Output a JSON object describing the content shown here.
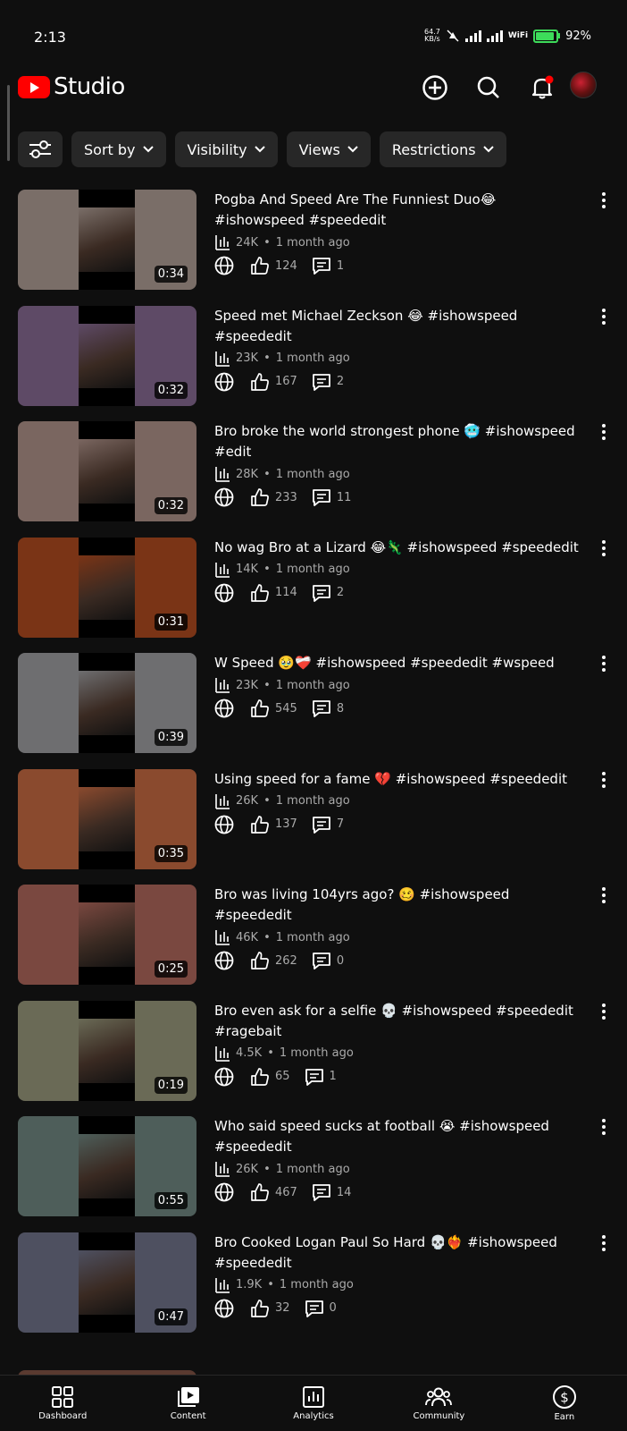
{
  "status_bar": {
    "time": "2:13",
    "net_speed_value": "64.7",
    "net_speed_unit": "KB/s",
    "wifi_label": "WiFi",
    "battery": "92%"
  },
  "header": {
    "app_name": "Studio"
  },
  "filters": [
    "Sort by",
    "Visibility",
    "Views",
    "Restrictions"
  ],
  "videos": [
    {
      "title": "Pogba And Speed Are The Funniest Duo😂 #ishowspeed #speededit",
      "views": "24K",
      "age": "1 month ago",
      "likes": "124",
      "comments": "1",
      "duration": "0:34",
      "color": "#7a6e68"
    },
    {
      "title": "Speed met Michael Zeckson 😂 #ishowspeed #speededit",
      "views": "23K",
      "age": "1 month ago",
      "likes": "167",
      "comments": "2",
      "duration": "0:32",
      "color": "#5e4a66"
    },
    {
      "title": "Bro broke the world strongest phone 🥶 #ishowspeed #edit",
      "views": "28K",
      "age": "1 month ago",
      "likes": "233",
      "comments": "11",
      "duration": "0:32",
      "color": "#7a6660"
    },
    {
      "title": "No wag Bro at a Lizard 😂🦎 #ishowspeed #speededit",
      "views": "14K",
      "age": "1 month ago",
      "likes": "114",
      "comments": "2",
      "duration": "0:31",
      "color": "#7a3416"
    },
    {
      "title": "W Speed 🥹❤️‍🩹 #ishowspeed #speededit #wspeed",
      "views": "23K",
      "age": "1 month ago",
      "likes": "545",
      "comments": "8",
      "duration": "0:39",
      "color": "#6e6e70"
    },
    {
      "title": "Using speed for a fame 💔 #ishowspeed #speededit",
      "views": "26K",
      "age": "1 month ago",
      "likes": "137",
      "comments": "7",
      "duration": "0:35",
      "color": "#8a4a2e"
    },
    {
      "title": "Bro was living 104yrs ago? 🥴 #ishowspeed #speededit",
      "views": "46K",
      "age": "1 month ago",
      "likes": "262",
      "comments": "0",
      "duration": "0:25",
      "color": "#7a4840"
    },
    {
      "title": "Bro even ask for a selfie 💀 #ishowspeed #speededit #ragebait",
      "views": "4.5K",
      "age": "1 month ago",
      "likes": "65",
      "comments": "1",
      "duration": "0:19",
      "color": "#6a6a56"
    },
    {
      "title": "Who said speed sucks at football 😭 #ishowspeed #speededit",
      "views": "26K",
      "age": "1 month ago",
      "likes": "467",
      "comments": "14",
      "duration": "0:55",
      "color": "#4e5e5a"
    },
    {
      "title": "Bro Cooked Logan Paul So Hard 💀❤️‍🔥 #ishowspeed #speededit",
      "views": "1.9K",
      "age": "1 month ago",
      "likes": "32",
      "comments": "0",
      "duration": "0:47",
      "color": "#4e5060"
    }
  ],
  "nav": [
    "Dashboard",
    "Content",
    "Analytics",
    "Community",
    "Earn"
  ],
  "icons": {
    "create": "plus-circle-icon",
    "search": "search-icon",
    "notifications": "bell-icon",
    "filter": "sliders-icon"
  }
}
